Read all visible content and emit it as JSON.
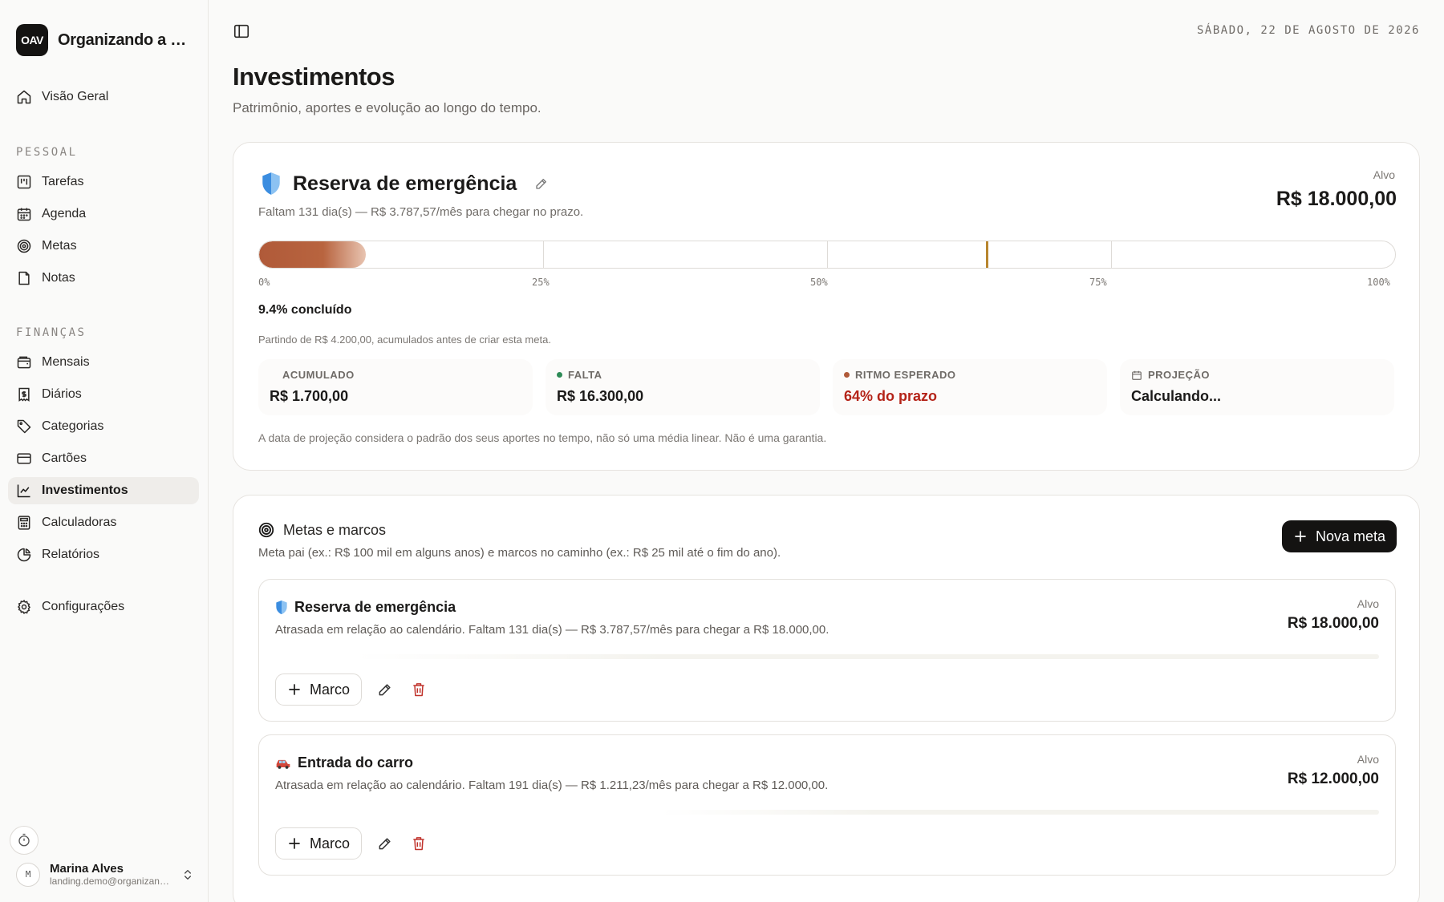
{
  "sidebar": {
    "brand_logo": "OAV",
    "brand_name": "Organizando a Vida",
    "overview": "Visão Geral",
    "section_personal": "PESSOAL",
    "personal_items": [
      "Tarefas",
      "Agenda",
      "Metas",
      "Notas"
    ],
    "section_finance": "FINANÇAS",
    "finance_items": [
      "Mensais",
      "Diários",
      "Categorias",
      "Cartões",
      "Investimentos",
      "Calculadoras",
      "Relatórios"
    ],
    "active_item": "Investimentos",
    "settings": "Configurações",
    "user": {
      "initial": "M",
      "name": "Marina Alves",
      "email": "landing.demo@organizando.app"
    }
  },
  "header": {
    "date": "SÁBADO, 22 DE AGOSTO DE 2026",
    "title": "Investimentos",
    "subtitle": "Patrimônio, aportes e evolução ao longo do tempo."
  },
  "emergency": {
    "title": "Reserva de emergência",
    "subtitle": "Faltam 131 dia(s) — R$ 3.787,57/mês para chegar no prazo.",
    "target_label": "Alvo",
    "target_value": "R$ 18.000,00",
    "progress_fraction": 0.094,
    "expected_fraction": 0.64,
    "scale": [
      "0%",
      "25%",
      "50%",
      "75%",
      "100%"
    ],
    "done_text": "9.4% concluído",
    "starting_text": "Partindo de R$ 4.200,00, acumulados antes de criar esta meta.",
    "stats": [
      {
        "label": "ACUMULADO",
        "value": "R$ 1.700,00"
      },
      {
        "label": "FALTA",
        "value": "R$ 16.300,00"
      },
      {
        "label": "RITMO ESPERADO",
        "value": "64% do prazo"
      },
      {
        "label": "PROJEÇÃO",
        "value": "Calculando..."
      }
    ],
    "disclaimer": "A data de projeção considera o padrão dos seus aportes no tempo, não só uma média linear. Não é uma garantia."
  },
  "goals_section": {
    "title": "Metas e marcos",
    "subtitle": "Meta pai (ex.: R$ 100 mil em alguns anos) e marcos no caminho (ex.: R$ 25 mil até o fim do ano).",
    "new_button": "Nova meta",
    "goals": [
      {
        "name": "Reserva de emergência",
        "desc": "Atrasada em relação ao calendário. Faltam 131 dia(s) — R$ 3.787,57/mês para chegar a R$ 18.000,00.",
        "target_label": "Alvo",
        "target_value": "R$ 18.000,00",
        "milestone_button": "Marco"
      },
      {
        "name": "Entrada do carro",
        "desc": "Atrasada em relação ao calendário. Faltam 191 dia(s) — R$ 1.211,23/mês para chegar a R$ 12.000,00.",
        "target_label": "Alvo",
        "target_value": "R$ 12.000,00",
        "milestone_button": "Marco"
      }
    ]
  },
  "colors": {
    "accent_progress": "#b05a39",
    "expected_marker": "#b8862f",
    "falta_dot": "#2e8b57",
    "ritmo_dot": "#b05a39",
    "ritmo_value": "#b42318",
    "delete": "#c0322b"
  }
}
